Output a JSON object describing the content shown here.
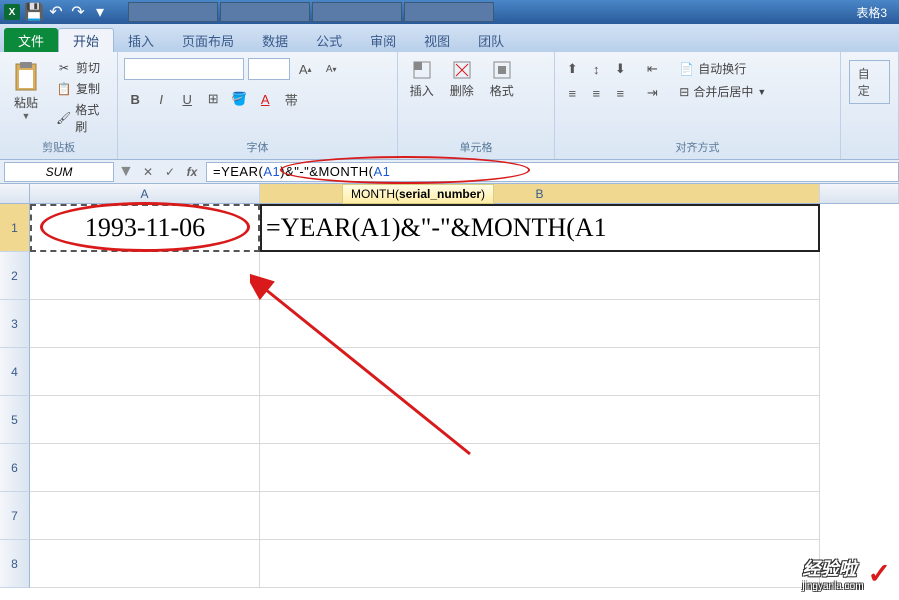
{
  "title_bar": {
    "doc_title": "表格3",
    "app_icon_letter": "X"
  },
  "ribbon_tabs": {
    "file": "文件",
    "home": "开始",
    "insert": "插入",
    "page_layout": "页面布局",
    "data": "数据",
    "formulas": "公式",
    "review": "审阅",
    "view": "视图",
    "team": "团队"
  },
  "ribbon": {
    "clipboard": {
      "label": "剪贴板",
      "paste": "粘贴",
      "cut": "剪切",
      "copy": "复制",
      "format_painter": "格式刷"
    },
    "font": {
      "label": "字体",
      "font_name": "",
      "font_size": "",
      "bold": "B",
      "italic": "I",
      "underline": "U",
      "size_up": "A",
      "size_down": "A"
    },
    "cells": {
      "label": "单元格",
      "insert": "插入",
      "delete": "删除",
      "format": "格式"
    },
    "alignment": {
      "label": "对齐方式",
      "wrap_text": "自动换行",
      "merge_center": "合并后居中"
    },
    "auto": {
      "label": "自定"
    }
  },
  "formula_bar": {
    "name_box": "SUM",
    "cancel": "✕",
    "enter": "✓",
    "fx": "fx",
    "formula_pre": "=YEAR(",
    "formula_ref1": "A1",
    "formula_mid": ")&\"-\"&MONTH(",
    "formula_ref2": "A1",
    "tooltip_fn": "MONTH(",
    "tooltip_arg": "serial_number",
    "tooltip_end": ")"
  },
  "grid": {
    "columns": [
      "A",
      "B"
    ],
    "rows": [
      "1",
      "2",
      "3",
      "4",
      "5",
      "6",
      "7",
      "8"
    ],
    "a1": "1993-11-06",
    "b1": "=YEAR(A1)&\"-\"&MONTH(A1"
  },
  "watermark": {
    "text": "经验啦",
    "sub": "jingyanla.com",
    "check": "✓"
  }
}
